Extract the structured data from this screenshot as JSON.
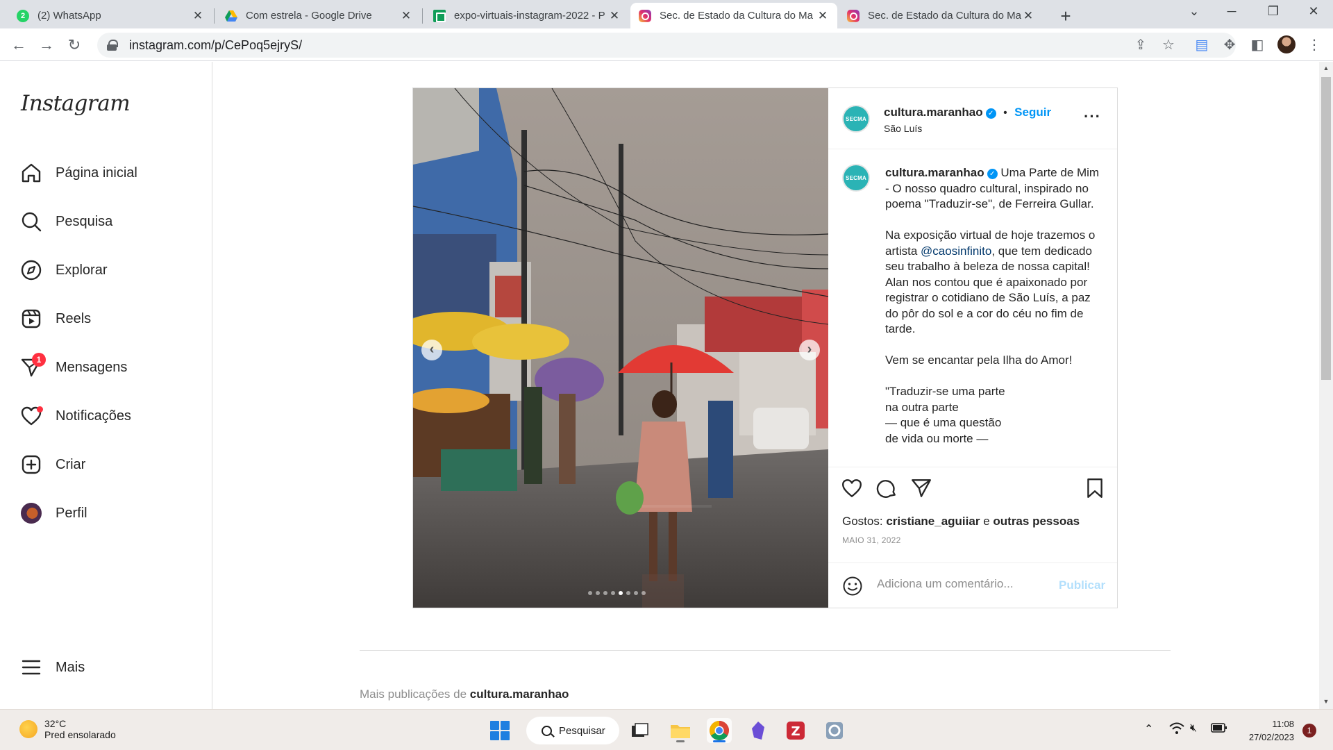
{
  "browser": {
    "tabs": [
      {
        "title": "(2) WhatsApp",
        "icon": "whatsapp-icon",
        "badge": "2"
      },
      {
        "title": "Com estrela - Google Drive",
        "icon": "google-drive-icon"
      },
      {
        "title": "expo-virtuais-instagram-2022 - P",
        "icon": "google-sheets-icon"
      },
      {
        "title": "Sec. de Estado da Cultura do Ma",
        "icon": "instagram-icon",
        "active": true
      },
      {
        "title": "Sec. de Estado da Cultura do Ma",
        "icon": "instagram-icon"
      }
    ],
    "url": "instagram.com/p/CePoq5ejryS/"
  },
  "sidebar": {
    "logo": "Instagram",
    "items": [
      {
        "label": "Página inicial",
        "icon": "home-icon"
      },
      {
        "label": "Pesquisa",
        "icon": "search-icon"
      },
      {
        "label": "Explorar",
        "icon": "compass-icon"
      },
      {
        "label": "Reels",
        "icon": "reels-icon"
      },
      {
        "label": "Mensagens",
        "icon": "messenger-icon",
        "badge": "1"
      },
      {
        "label": "Notificações",
        "icon": "heart-icon"
      },
      {
        "label": "Criar",
        "icon": "plus-square-icon"
      },
      {
        "label": "Perfil",
        "icon": "profile-avatar"
      }
    ],
    "more": "Mais"
  },
  "post": {
    "username": "cultura.maranhao",
    "follow": "Seguir",
    "location": "São Luís",
    "avatar_text": "SECMA",
    "caption": {
      "first": "Uma Parte de Mim - O nosso quadro cultural, inspirado no poema \"Traduzir-se\", de Ferreira Gullar.",
      "p2_before": "Na exposição virtual de hoje trazemos o artista ",
      "mention": "@caosinfinito",
      "p2_after": ", que tem dedicado seu trabalho à beleza de nossa capital! Alan nos contou que é apaixonado por registrar o cotidiano de São Luís, a paz do pôr do sol e a cor do céu no fim de tarde.",
      "p3": "Vem se encantar pela Ilha do Amor!",
      "poem": [
        "\"Traduzir-se uma parte",
        "na outra parte",
        "— que é uma questão",
        "de vida ou morte —"
      ]
    },
    "likes_prefix": "Gostos:",
    "likes_user": "cristiane_aguiiar",
    "likes_and": "e",
    "likes_others": "outras pessoas",
    "date": "MAIO 31, 2022",
    "comment_placeholder": "Adiciona um comentário...",
    "publish": "Publicar",
    "carousel": {
      "count": 8,
      "current": 5
    }
  },
  "more_posts": {
    "prefix": "Mais publicações de",
    "user": "cultura.maranhao"
  },
  "taskbar": {
    "temp": "32°C",
    "weather": "Pred ensolarado",
    "search": "Pesquisar",
    "time": "11:08",
    "date": "27/02/2023",
    "notifications": "1"
  },
  "colors": {
    "accent": "#0095f6",
    "badge": "#ff3040",
    "mention": "#00376b",
    "publish_disabled": "#b2dffc"
  }
}
